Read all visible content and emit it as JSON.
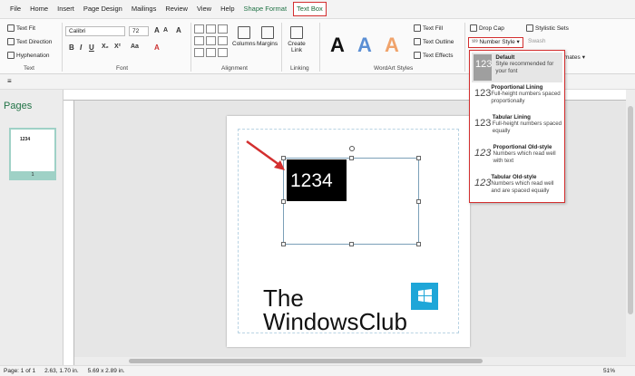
{
  "tabs": [
    "File",
    "Home",
    "Insert",
    "Page Design",
    "Mailings",
    "Review",
    "View",
    "Help",
    "Shape Format",
    "Text Box"
  ],
  "ribbon": {
    "text_fit": "Text Fit",
    "text_direction": "Text Direction",
    "hyphenation": "Hyphenation",
    "text_group": "Text",
    "font_name": "Calibri",
    "font_size": "72",
    "font_group": "Font",
    "columns": "Columns",
    "margins": "Margins",
    "alignment_group": "Alignment",
    "create_link": "Create Link",
    "linking_group": "Linking",
    "wordart_group": "WordArt Styles",
    "text_fill": "Text Fill",
    "text_outline": "Text Outline",
    "text_effects": "Text Effects",
    "drop_cap": "Drop Cap",
    "stylistic_sets": "Stylistic Sets",
    "number_style": "Number Style",
    "swash": "Swash",
    "mates": "mates"
  },
  "pages_pane": {
    "title": "Pages",
    "thumb_text": "1234",
    "page_number": "1"
  },
  "document": {
    "number_text": "1234",
    "logo_line1": "The",
    "logo_line2": "WindowsClub"
  },
  "status": {
    "page": "Page: 1 of 1",
    "position": "2.63, 1.70 in.",
    "size": "5.69 x 2.89 in.",
    "zoom": "51%"
  },
  "number_style_menu": [
    {
      "icon": "123",
      "title": "Default",
      "desc": "Style recommended for your font"
    },
    {
      "icon": "123",
      "title": "Proportional Lining",
      "desc": "Full-height numbers spaced proportionally"
    },
    {
      "icon": "123",
      "title": "Tabular Lining",
      "desc": "Full-height numbers spaced equally"
    },
    {
      "icon": "123",
      "title": "Proportional Old-style",
      "desc": "Numbers which read well with text"
    },
    {
      "icon": "123",
      "title": "Tabular Old-style",
      "desc": "Numbers which read well and are spaced equally"
    }
  ],
  "colors": {
    "accent": "#217346",
    "highlight": "#d32f2f"
  }
}
